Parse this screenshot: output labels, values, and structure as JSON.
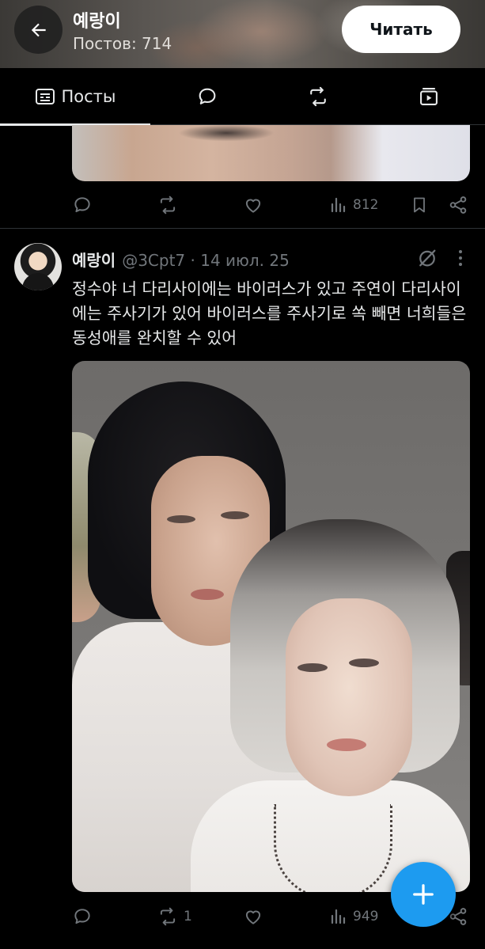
{
  "header": {
    "back_icon": "arrow-left-icon",
    "display_name": "예랑이",
    "post_count": "Постов: 714",
    "follow_label": "Читать"
  },
  "tabs": [
    {
      "label": "Посты",
      "icon": "posts-icon",
      "selected": true
    },
    {
      "label": "",
      "icon": "reply-bubble-icon",
      "selected": false
    },
    {
      "label": "",
      "icon": "repost-icon",
      "selected": false
    },
    {
      "label": "",
      "icon": "video-icon",
      "selected": false
    }
  ],
  "previous_post": {
    "views": "812"
  },
  "post": {
    "name": "예랑이",
    "meta": "@3Cpt7 · 14 июл. 25",
    "text": "정수야 너 다리사이에는 바이러스가 있고 주연이 다리사이에는 주사기가 있어 바이러스를 주사기로 쏙 빼면 너희들은 동성애를 완치할 수 있어",
    "reposts": "1",
    "views": "949"
  },
  "colors": {
    "accent": "#1d9bf0",
    "background": "#000000",
    "muted": "#71767b",
    "text": "#e7e9ea"
  }
}
